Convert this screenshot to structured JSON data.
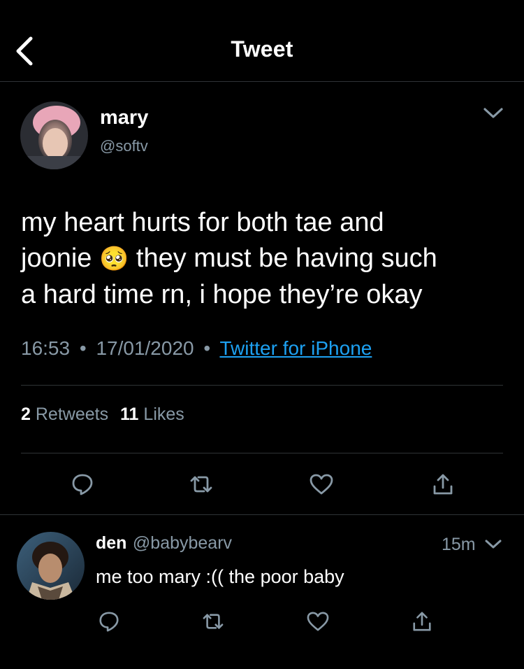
{
  "header": {
    "title": "Tweet"
  },
  "tweet": {
    "author_name": "mary",
    "author_handle": "@softv",
    "text_line1": "my heart hurts for both tae and",
    "text_line2_a": "joonie",
    "emoji": "🥺",
    "text_line2_b": "they must be having such",
    "text_line3": "a hard time rn, i hope they’re okay",
    "time": "16:53",
    "sep": "•",
    "date": "17/01/2020",
    "source": "Twitter for iPhone",
    "retweets_count": "2",
    "retweets_label": "Retweets",
    "likes_count": "11",
    "likes_label": "Likes"
  },
  "reply": {
    "author_name": "den",
    "author_handle": "@babybearv",
    "time": "15m",
    "text": "me too mary :(( the poor baby"
  },
  "colors": {
    "accent": "#1da1f2",
    "muted": "#8899a6",
    "divider": "#2f3336"
  }
}
